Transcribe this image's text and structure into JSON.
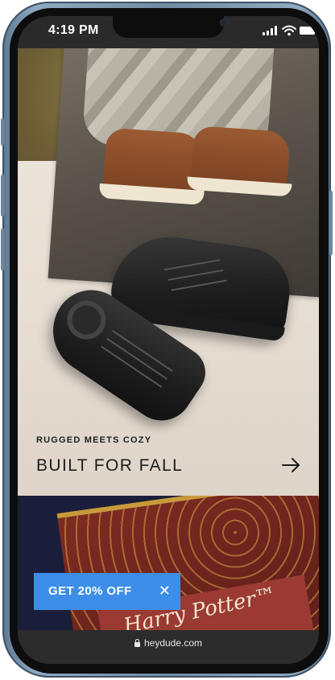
{
  "status_bar": {
    "time": "4:19 PM",
    "icons": [
      "signal-icon",
      "wifi-icon",
      "battery-icon"
    ]
  },
  "hero": {
    "eyebrow": "RUGGED MEETS COZY",
    "headline": "BUILT FOR FALL",
    "arrow_icon": "arrow-right-icon"
  },
  "feature": {
    "label_text": "Harry Potter™"
  },
  "promo": {
    "label": "GET 20% OFF",
    "close_icon": "close-icon",
    "color": "#3d8ee8"
  },
  "browser": {
    "domain": "heydude.com",
    "lock_icon": "lock-icon"
  }
}
